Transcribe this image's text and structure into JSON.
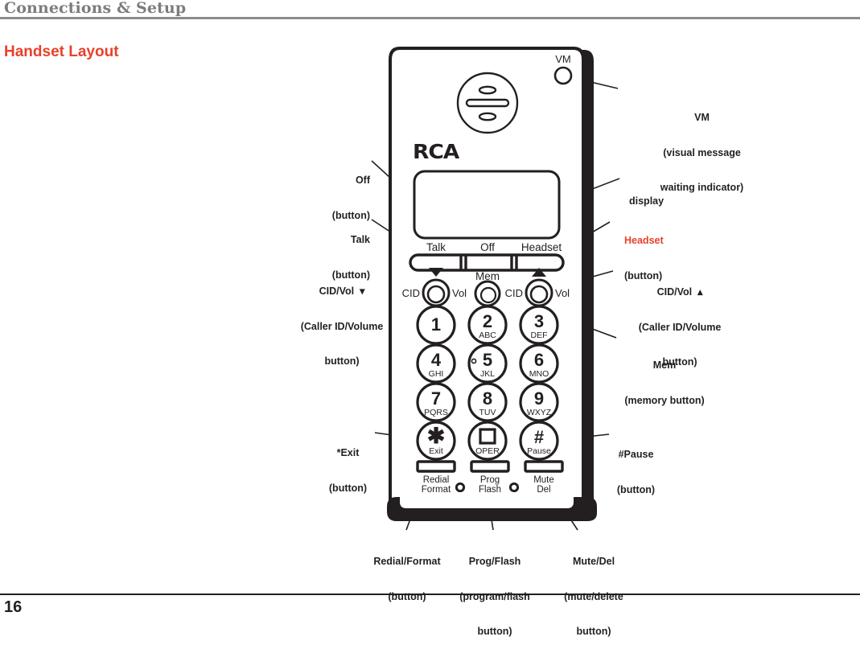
{
  "header": {
    "chapter_title": "Connections & Setup",
    "rule_color": "#8c8c8c"
  },
  "section": {
    "title": "Handset Layout",
    "title_color": "#e8412a"
  },
  "footer": {
    "page_number": "16"
  },
  "handset": {
    "brand_logo": "RCA",
    "vm_label": "VM",
    "softkeys": [
      {
        "label": "Talk"
      },
      {
        "label": "Off"
      },
      {
        "label": "Headset"
      }
    ],
    "rocker_left": {
      "cid": "CID",
      "vol": "Vol",
      "arrow": "▼"
    },
    "rocker_right": {
      "cid": "CID",
      "vol": "Vol",
      "arrow": "▲"
    },
    "mem_label": "Mem",
    "keypad": [
      {
        "digit": "1",
        "letters": ""
      },
      {
        "digit": "2",
        "letters": "ABC"
      },
      {
        "digit": "3",
        "letters": "DEF"
      },
      {
        "digit": "4",
        "letters": "GHI"
      },
      {
        "digit": "5",
        "letters": "JKL"
      },
      {
        "digit": "6",
        "letters": "MNO"
      },
      {
        "digit": "7",
        "letters": "PQRS"
      },
      {
        "digit": "8",
        "letters": "TUV"
      },
      {
        "digit": "9",
        "letters": "WXYZ"
      },
      {
        "digit": "✱",
        "letters": "Exit"
      },
      {
        "digit": "■",
        "letters": "OPER"
      },
      {
        "digit": "#",
        "letters": "Pause"
      }
    ],
    "bottom_keys": [
      {
        "line1": "Redial",
        "line2": "Format"
      },
      {
        "line1": "Prog",
        "line2": "Flash"
      },
      {
        "line1": "Mute",
        "line2": "Del"
      }
    ]
  },
  "callouts": {
    "off": {
      "line1": "Off",
      "line2": "(button)"
    },
    "talk": {
      "line1": "Talk",
      "line2": "(button)"
    },
    "cid_vol_down": {
      "line1": "CID/Vol  ▾",
      "line2": "(Caller ID/Volume",
      "line3": "button)"
    },
    "star_exit": {
      "line1": "*Exit",
      "line2": "(button)"
    },
    "vm": {
      "line1": "VM",
      "line2": "(visual message",
      "line3": "waiting indicator)"
    },
    "display": {
      "line1": "display"
    },
    "headset": {
      "line1": "Headset",
      "line2": "(button)"
    },
    "cid_vol_up": {
      "line1": "CID/Vol  ▴",
      "line2": "(Caller ID/Volume",
      "line3": "button)"
    },
    "mem": {
      "line1": "Mem",
      "line2": "(memory button)"
    },
    "pound_pause": {
      "line1": "#Pause",
      "line2": "(button)"
    },
    "redial_format": {
      "line1": "Redial/Format",
      "line2": "(button)"
    },
    "prog_flash": {
      "line1": "Prog/Flash",
      "line2": "(program/flash",
      "line3": "button)"
    },
    "mute_del": {
      "line1": "Mute/Del",
      "line2": "(mute/delete",
      "line3": "button)"
    }
  }
}
